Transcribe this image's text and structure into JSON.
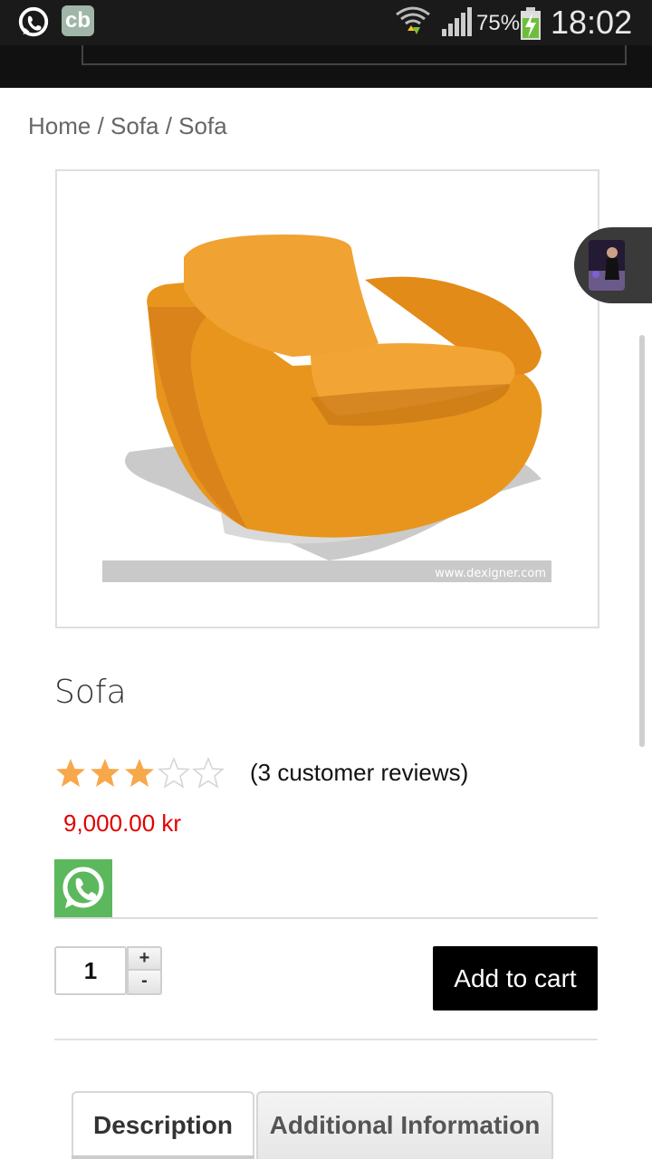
{
  "status_bar": {
    "battery": "75%",
    "time": "18:02",
    "cb_label": "cb",
    "icons": [
      "whatsapp-icon",
      "cb-app-icon",
      "wifi-icon",
      "signal-icon",
      "battery-charging-icon"
    ]
  },
  "breadcrumb": "Home / Sofa / Sofa",
  "product": {
    "image_watermark": "www.dexigner.com",
    "title": "Sofa",
    "rating": 3,
    "rating_max": 5,
    "reviews_text": "(3 customer reviews)",
    "price": "9,000.00 kr",
    "quantity": "1",
    "plus_label": "+",
    "minus_label": "-",
    "add_to_cart": "Add to cart"
  },
  "tabs": [
    {
      "label": "Description",
      "active": true
    },
    {
      "label": "Additional Information",
      "active": false
    }
  ],
  "colors": {
    "price": "#e10000",
    "star_filled": "#f7a84a",
    "whatsapp": "#5cb85c",
    "sofa": "#e8951e"
  }
}
